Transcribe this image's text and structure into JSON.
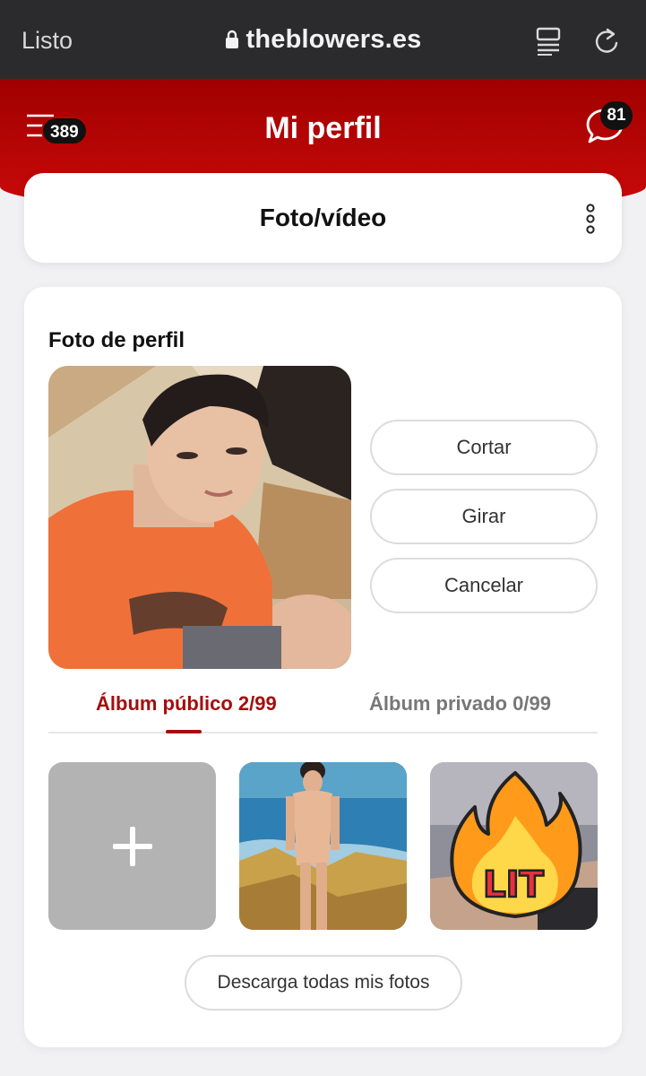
{
  "browser": {
    "done_label": "Listo",
    "url": "theblowers.es"
  },
  "header": {
    "title": "Mi perfil",
    "menu_badge": "389",
    "chat_badge": "81"
  },
  "section_header": {
    "title": "Foto/vídeo"
  },
  "profile": {
    "section_title": "Foto de perfil",
    "actions": [
      "Cortar",
      "Girar",
      "Cancelar"
    ]
  },
  "tabs": {
    "public_label": "Álbum público 2/99",
    "private_label": "Álbum privado 0/99"
  },
  "album": {
    "lit_sticker_text": "LIT"
  },
  "download_label": "Descarga todas mis fotos",
  "colors": {
    "brand_red": "#a50d0d",
    "header_red": "#c00808",
    "badge_black": "#111111"
  },
  "icons": [
    "lock-icon",
    "reader-mode-icon",
    "reload-icon",
    "menu-icon",
    "chat-icon",
    "kebab-menu-icon",
    "plus-icon"
  ]
}
